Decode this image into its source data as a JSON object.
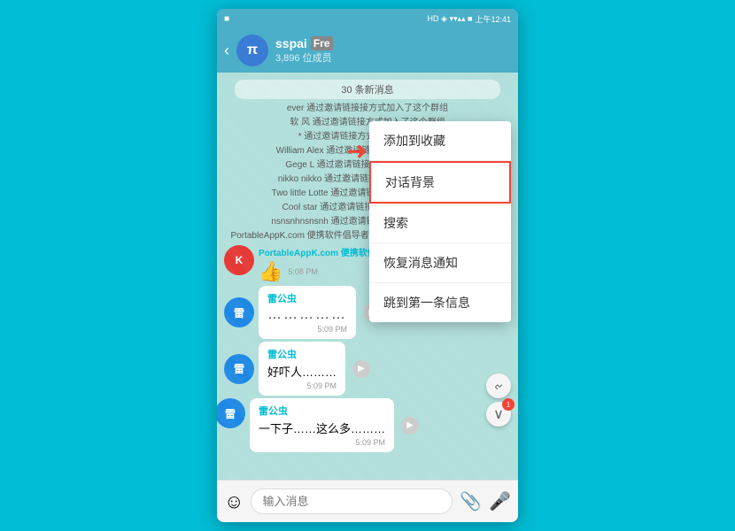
{
  "statusBar": {
    "leftIcon": "■",
    "signal": "HD ◈ ▾▾▴▴",
    "time": "上午12:41",
    "batteryText": "▉"
  },
  "header": {
    "backLabel": "‹",
    "avatarLabel": "π",
    "name": "sspai",
    "muteLabel": "Fre",
    "memberCount": "3,896 位成员"
  },
  "newMessagesBar": "30 条新消息",
  "systemMessages": [
    "ever 通过邀请链接接方式加入了这个群组",
    "软 风 通过邀请链接方式加入了这个群组",
    "* 通过邀请链接方式加入了这个群组",
    "William Alex 通过邀请链接方式加入了这个群组",
    "Gege L 通过邀请链接方式加入了这个群组",
    "nikko nikko 通过邀请链接方式加入了这个群组",
    "Two little Lotte 通过邀请链接方式加入了这个群组",
    "Cool star 通过邀请链接方式加入了这个群组",
    "nsnsnhnsnsnh 通过邀请链接方式加入了这个群组",
    "PortableAppK.com 便携软件倡导者 通过邀请链接方式加入了这个群组"
  ],
  "portableSender": "PortableAppK.com 便携软件倡导者",
  "portableMsg": "👍",
  "portableTime": "5:08 PM",
  "messages": [
    {
      "sender": "雷公虫",
      "content": "……………",
      "time": "5:09 PM",
      "showForward": true
    },
    {
      "sender": "雷公虫",
      "content": "好吓人………",
      "time": "5:09 PM",
      "showForward": true
    },
    {
      "sender": "雷公虫",
      "content": "一下子……这么多………",
      "time": "5:09 PM",
      "showForward": true
    }
  ],
  "scrollBadge": "1",
  "inputPlaceholder": "输入消息",
  "contextMenu": {
    "items": [
      {
        "label": "添加到收藏",
        "highlighted": false
      },
      {
        "label": "对话背景",
        "highlighted": true
      },
      {
        "label": "搜索",
        "highlighted": false
      },
      {
        "label": "恢复消息通知",
        "highlighted": false
      },
      {
        "label": "跳到第一条信息",
        "highlighted": false
      }
    ]
  },
  "avatarColors": {
    "portable": "#E53935",
    "thunder": "#1E88E5"
  }
}
